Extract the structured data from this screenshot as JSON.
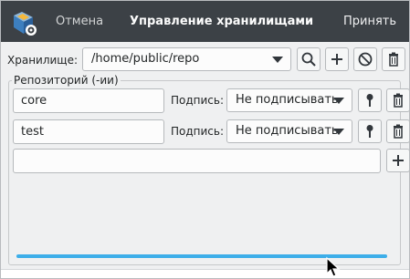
{
  "header": {
    "cancel_label": "Отмена",
    "title": "Управление хранилищами",
    "accept_label": "Принять"
  },
  "storage": {
    "label": "Хранилище:",
    "value": "/home/public/repo"
  },
  "repositories": {
    "group_title": "Репозиторий (-ии)",
    "signature_label": "Подпись:",
    "rows": [
      {
        "name": "core",
        "signature": "Не подписывать"
      },
      {
        "name": "test",
        "signature": "Не подписывать"
      }
    ],
    "new_name": ""
  },
  "colors": {
    "header_bg": "#3c4146",
    "window_bg": "#eff0f1",
    "accent": "#3daee9"
  },
  "icons": [
    "app-icon",
    "search-icon",
    "plus-icon",
    "disable-icon",
    "trash-icon",
    "key-icon",
    "chevron-down-icon",
    "mouse-cursor-icon"
  ]
}
